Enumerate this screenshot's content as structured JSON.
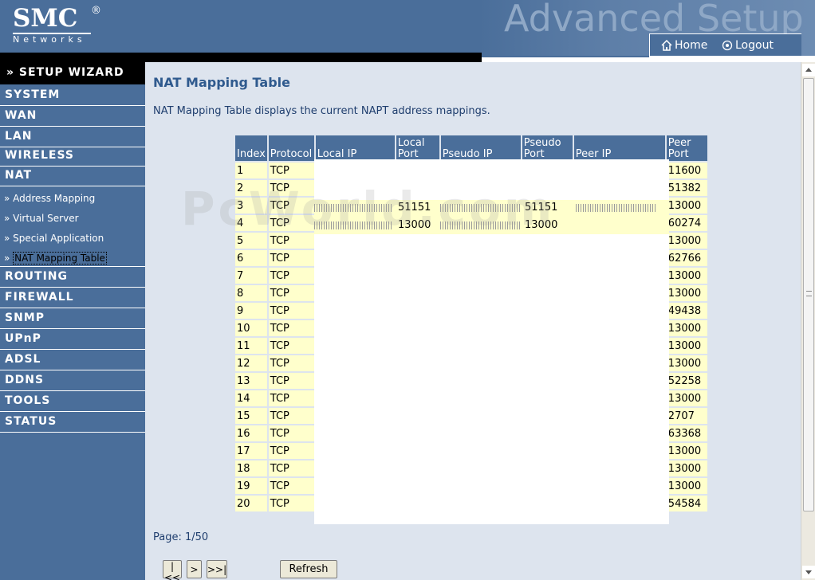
{
  "header": {
    "brand": "SMC",
    "brand_reg": "®",
    "brand_sub": "Networks",
    "title": "Advanced Setup",
    "home_label": "Home",
    "logout_label": "Logout"
  },
  "sidebar": {
    "wizard": "» SETUP WIZARD",
    "categories": [
      "SYSTEM",
      "WAN",
      "LAN",
      "WIRELESS",
      "NAT",
      "ROUTING",
      "FIREWALL",
      "SNMP",
      "UPnP",
      "ADSL",
      "DDNS",
      "TOOLS",
      "STATUS"
    ],
    "nat_sub": [
      "» Address Mapping",
      "» Virtual Server",
      "» Special Application",
      "NAT Mapping Table"
    ],
    "nat_sub_active_prefix": "»"
  },
  "main": {
    "title": "NAT Mapping Table",
    "description": "NAT Mapping Table displays the current NAPT address mappings.",
    "page_info": "Page: 1/50",
    "buttons": {
      "first": "|<<",
      "next": ">",
      "last": ">>|",
      "refresh": "Refresh"
    },
    "watermark": "PcWorld.com"
  },
  "table": {
    "headers": [
      "Index",
      "Protocol",
      "Local IP",
      "Local Port",
      "Pseudo IP",
      "Pseudo Port",
      "Peer IP",
      "Peer Port"
    ],
    "rows": [
      [
        "1",
        "TCP",
        "11600"
      ],
      [
        "2",
        "TCP",
        "51382"
      ],
      [
        "3",
        "TCP",
        "13000"
      ],
      [
        "4",
        "TCP",
        "60274"
      ],
      [
        "5",
        "TCP",
        "13000"
      ],
      [
        "6",
        "TCP",
        "62766"
      ],
      [
        "7",
        "TCP",
        "13000"
      ],
      [
        "8",
        "TCP",
        "13000"
      ],
      [
        "9",
        "TCP",
        "49438"
      ],
      [
        "10",
        "TCP",
        "13000"
      ],
      [
        "11",
        "TCP",
        "13000"
      ],
      [
        "12",
        "TCP",
        "13000"
      ],
      [
        "13",
        "TCP",
        "52258"
      ],
      [
        "14",
        "TCP",
        "13000"
      ],
      [
        "15",
        "TCP",
        "2707"
      ],
      [
        "16",
        "TCP",
        "63368"
      ],
      [
        "17",
        "TCP",
        "13000"
      ],
      [
        "18",
        "TCP",
        "13000"
      ],
      [
        "19",
        "TCP",
        "13000"
      ],
      [
        "20",
        "TCP",
        "54584"
      ]
    ],
    "row3_visible": {
      "local_port": "51151",
      "pseudo_port": "51151"
    },
    "row4_visible": {
      "local_port": "13000",
      "pseudo_port": "13000"
    }
  },
  "colors": {
    "nav_blue": "#4a6e9a",
    "content_bg": "#dde4ee",
    "cell_yellow": "#ffffcc",
    "title_blue": "#2f5a8e"
  }
}
